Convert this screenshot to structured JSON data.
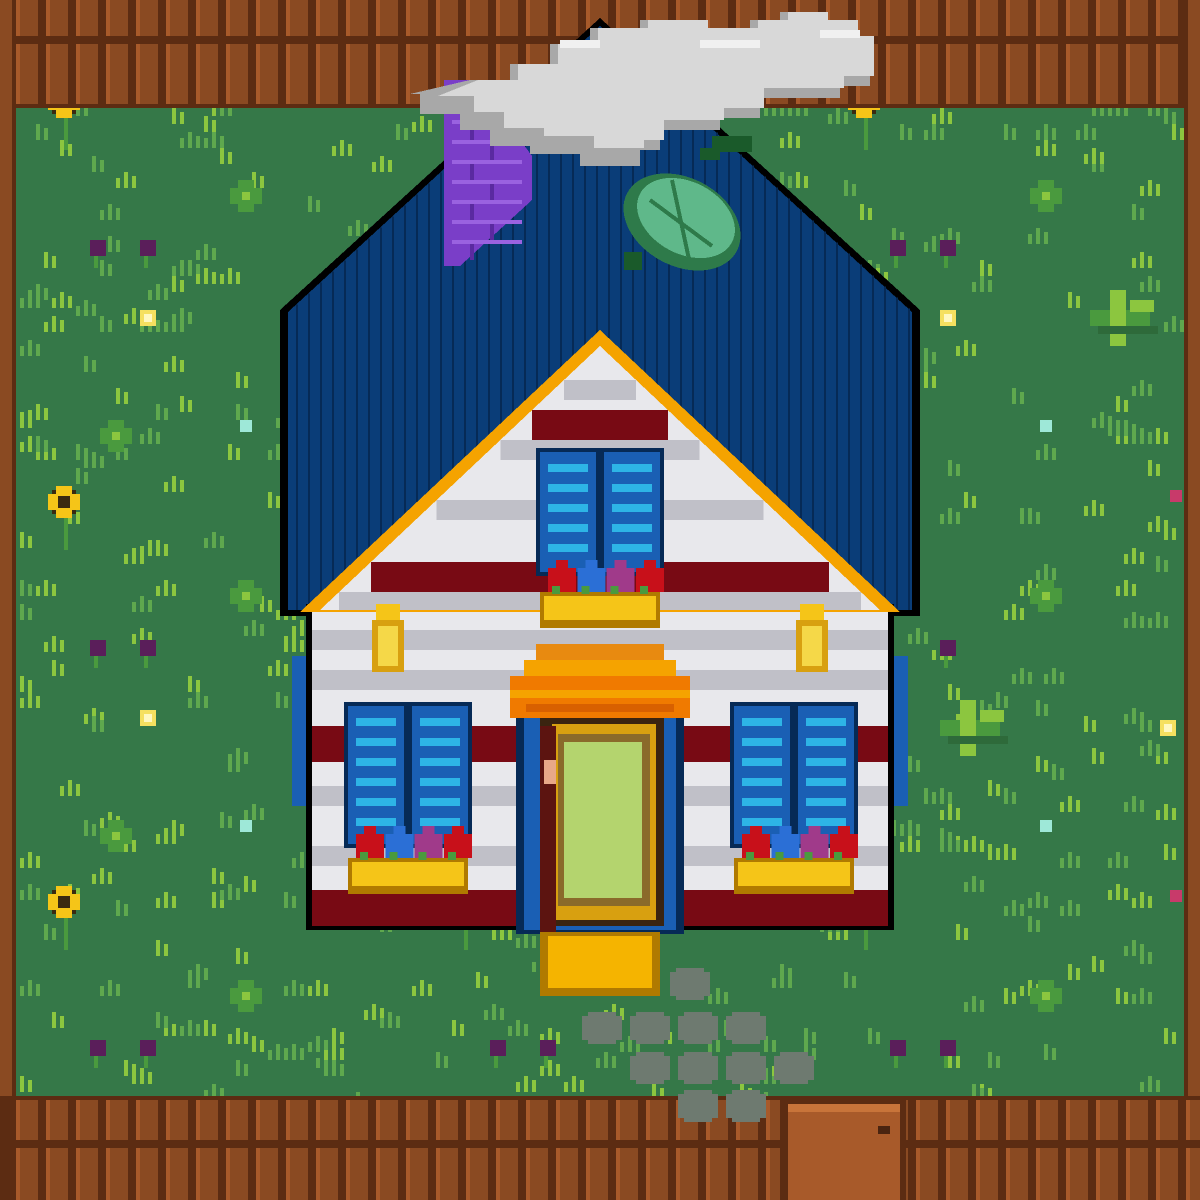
{
  "scene": {
    "type": "pixel-art top-down farm cottage",
    "elements": [
      "fence",
      "grass-field",
      "cottage",
      "blue-roof",
      "chimney",
      "satellite-dish",
      "smoke-cloud",
      "door",
      "awning",
      "windows",
      "flower-boxes",
      "lamps",
      "doormat",
      "stone-path",
      "gate"
    ]
  },
  "palette": {
    "grass": "#357848",
    "grass_light": "#5fa84e",
    "grass_tuft": "#8cc63f",
    "fence": "#8a4a22",
    "fence_dark": "#5c2c12",
    "roof": "#0a3d78",
    "roof_dark": "#062a56",
    "roof_trim": "#f5a300",
    "wall_white": "#e8e8ec",
    "wall_grey": "#c0c0c8",
    "wall_red": "#780a14",
    "shutter": "#1a5fb4",
    "shutter_slat": "#2db4e6",
    "awning": "#f07a00",
    "door_glass": "#b4d46e",
    "doormat": "#f5b400",
    "chimney": "#7a3ec8",
    "dish": "#5fb88a",
    "smoke": "#d8d8d8",
    "stone": "#6e7a70",
    "sunflower": "#f5c518"
  }
}
